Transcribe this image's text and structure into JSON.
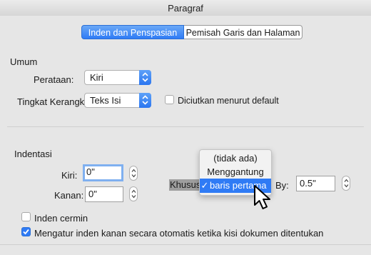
{
  "window": {
    "title": "Paragraf"
  },
  "tabs": [
    {
      "label": "Inden dan Penspasian",
      "active": true
    },
    {
      "label": "Pemisah Garis dan Halaman",
      "active": false
    }
  ],
  "umum": {
    "heading": "Umum",
    "alignment_label": "Perataan:",
    "alignment_value": "Kiri",
    "outline_label": "Tingkat Kerangka:",
    "outline_value": "Teks Isi",
    "collapsed_label": "Diciutkan menurut default",
    "collapsed_checked": false
  },
  "indentation": {
    "heading": "Indentasi",
    "left_label": "Kiri:",
    "left_value": "0\"",
    "right_label": "Kanan:",
    "right_value": "0\"",
    "special_label": "Khusus:",
    "by_label": "By:",
    "by_value": "0.5\"",
    "mirror_label": "Inden cermin",
    "mirror_checked": false,
    "auto_adjust_label": "Mengatur inden kanan secara otomatis ketika kisi dokumen ditentukan",
    "auto_adjust_checked": true
  },
  "special_menu": {
    "options": [
      "(tidak ada)",
      "Menggantung",
      "baris pertama"
    ],
    "selected": "baris pertama",
    "checkmark": "✓"
  },
  "colors": {
    "accent": "#2f7bf5",
    "background": "#e6e6e6"
  }
}
